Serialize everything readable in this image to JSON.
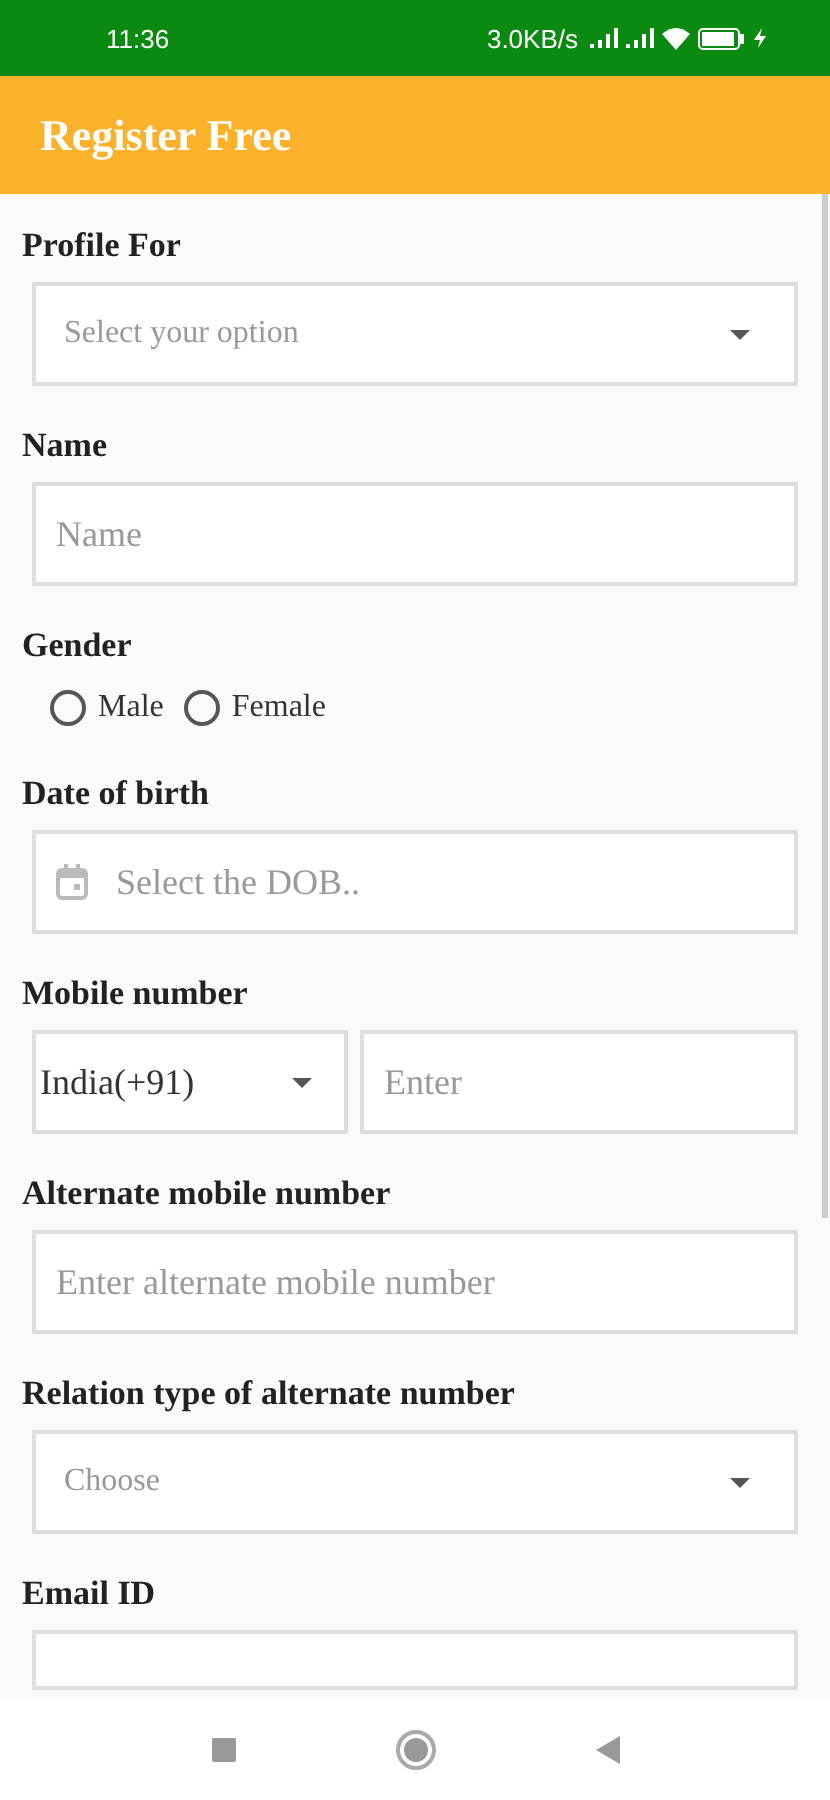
{
  "status_bar": {
    "time": "11:36",
    "speed": "3.0KB/s"
  },
  "app_bar": {
    "title": "Register Free"
  },
  "fields": [
    {
      "kind": "select",
      "label": "Profile For",
      "placeholder": "Select your option"
    },
    {
      "kind": "text",
      "label": "Name",
      "placeholder": "Name"
    },
    {
      "kind": "radio",
      "label": "Gender",
      "options": [
        {
          "label": "Male",
          "selected": false
        },
        {
          "label": "Female",
          "selected": false
        }
      ]
    },
    {
      "kind": "date",
      "label": "Date of birth",
      "placeholder": "Select the DOB.."
    },
    {
      "kind": "phone",
      "label": "Mobile number",
      "country": "India(+91)",
      "placeholder": "Enter"
    },
    {
      "kind": "text",
      "label": "Alternate mobile number",
      "placeholder": "Enter alternate mobile number"
    },
    {
      "kind": "select",
      "label": "Relation type of alternate number",
      "placeholder": "Choose"
    },
    {
      "kind": "text",
      "label": "Email ID"
    }
  ]
}
